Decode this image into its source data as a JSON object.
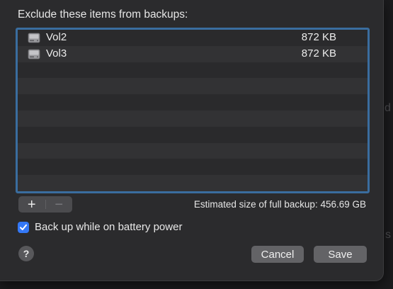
{
  "dialog": {
    "heading": "Exclude these items from backups:",
    "items": [
      {
        "name": "Vol2",
        "size": "872 KB",
        "icon": "disk-icon"
      },
      {
        "name": "Vol3",
        "size": "872 KB",
        "icon": "disk-icon"
      }
    ],
    "add_label": "+",
    "remove_label": "−",
    "estimate": "Estimated size of full backup: 456.69 GB",
    "battery_label": "Back up while on battery power",
    "battery_checked": true,
    "help_label": "?",
    "cancel_label": "Cancel",
    "save_label": "Save"
  },
  "background": {
    "edge_letter_1": "d",
    "edge_letter_2": "s"
  },
  "colors": {
    "accent": "#3478f6",
    "focus_ring": "#3a6d9f",
    "sheet_bg": "#2b2b2d",
    "button_bg": "#636366"
  }
}
